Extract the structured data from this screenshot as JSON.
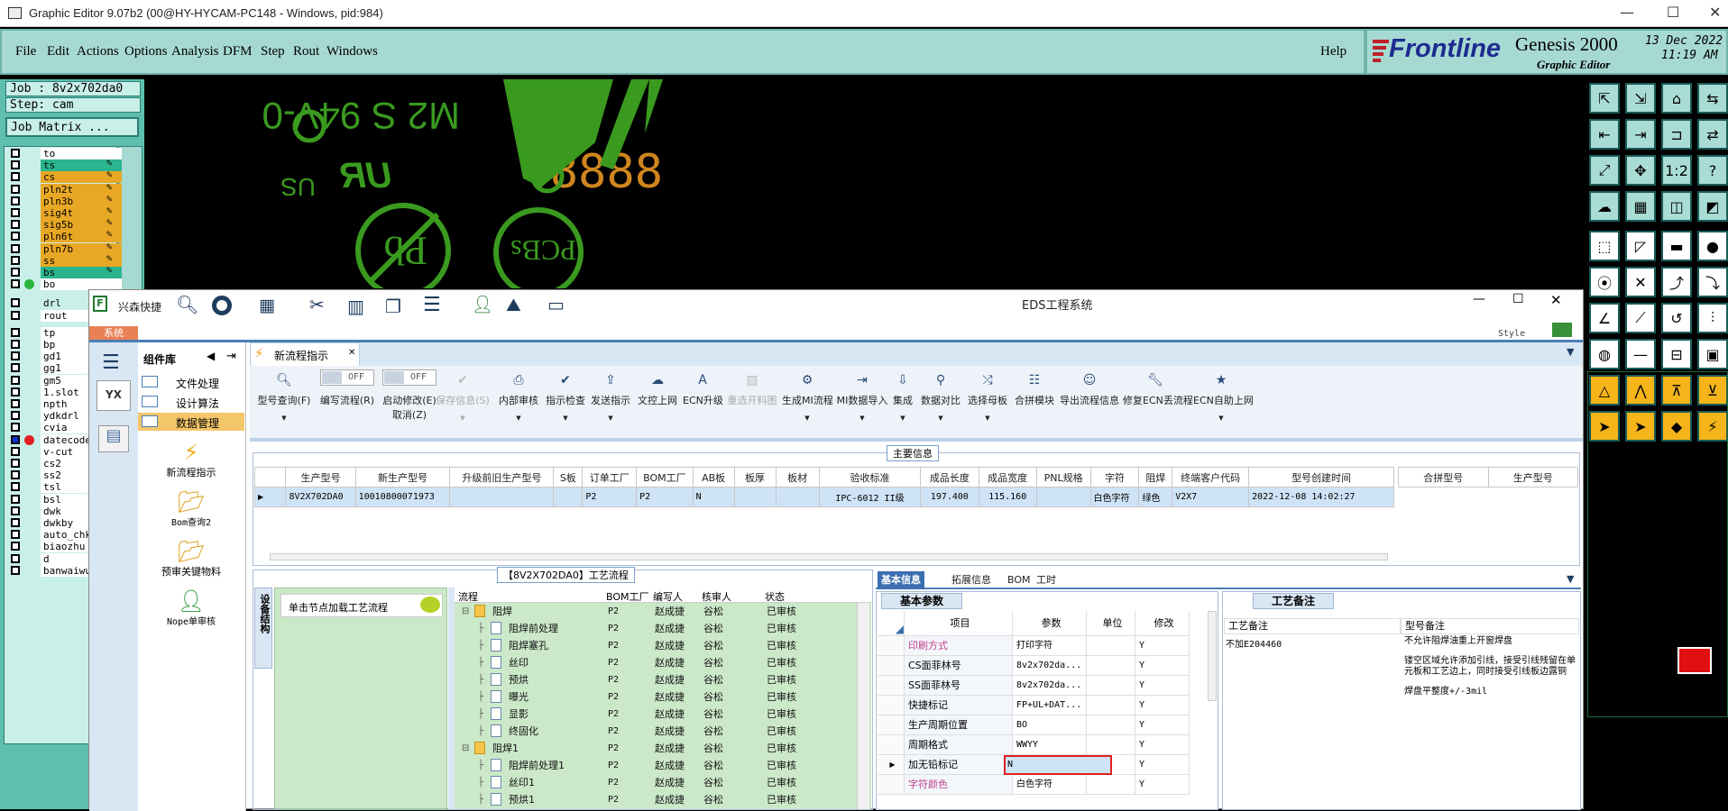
{
  "genesis": {
    "title": "Graphic Editor 9.07b2 (00@HY-HYCAM-PC148 - Windows, pid:984)",
    "menu": [
      "File",
      "Edit",
      "Actions",
      "Options",
      "Analysis",
      "DFM",
      "Step",
      "Rout",
      "Windows"
    ],
    "help": "Help",
    "brand": "Frontline",
    "product": "Genesis 2000",
    "subtitle": "Graphic Editor",
    "date": "13 Dec 2022",
    "time": "11:19 AM",
    "job": "Job : 8v2x702da0",
    "step": "Step: cam",
    "job_matrix": "Job Matrix ...",
    "layers": [
      {
        "name": "to",
        "color": "#ffffff"
      },
      {
        "name": "ts",
        "color": "#2bb58e"
      },
      {
        "name": "cs",
        "color": "#e8a825"
      },
      {
        "name": "pln2t",
        "color": "#e8a825"
      },
      {
        "name": "pln3b",
        "color": "#e8a825"
      },
      {
        "name": "sig4t",
        "color": "#e8a825"
      },
      {
        "name": "sig5b",
        "color": "#e8a825"
      },
      {
        "name": "pln6t",
        "color": "#e8a825"
      },
      {
        "name": "pln7b",
        "color": "#e8a825"
      },
      {
        "name": "ss",
        "color": "#e8a825"
      },
      {
        "name": "bs",
        "color": "#2bb58e"
      },
      {
        "name": "bo",
        "color": "#ffffff"
      },
      {
        "name": "drl",
        "color": "#c9efe9"
      },
      {
        "name": "rout",
        "color": "#ffffff"
      },
      {
        "name": "tp",
        "color": "#ffffff"
      },
      {
        "name": "bp",
        "color": "#ffffff"
      },
      {
        "name": "gd1",
        "color": "#ffffff"
      },
      {
        "name": "gg1",
        "color": "#ffffff"
      },
      {
        "name": "gm5",
        "color": "#ffffff"
      },
      {
        "name": "1.slot",
        "color": "#ffffff"
      },
      {
        "name": "npth",
        "color": "#ffffff"
      },
      {
        "name": "ydkdrl",
        "color": "#ffffff"
      },
      {
        "name": "cvia",
        "color": "#ffffff"
      },
      {
        "name": "datecode",
        "color": "#ffffff"
      },
      {
        "name": "v-cut",
        "color": "#ffffff"
      },
      {
        "name": "cs2",
        "color": "#ffffff"
      },
      {
        "name": "ss2",
        "color": "#ffffff"
      },
      {
        "name": "tsl",
        "color": "#ffffff"
      },
      {
        "name": "bsl",
        "color": "#ffffff"
      },
      {
        "name": "dwk",
        "color": "#ffffff"
      },
      {
        "name": "dwkby",
        "color": "#ffffff"
      },
      {
        "name": "auto_chk",
        "color": "#ffffff"
      },
      {
        "name": "biaozhu",
        "color": "#ffffff"
      },
      {
        "name": "d",
        "color": "#ffffff"
      },
      {
        "name": "banwaiwu",
        "color": "#ffffff"
      }
    ],
    "canvas_text": {
      "ul": "M2 S 94V-0",
      "digits": "8888",
      "us": "US",
      "pcbs": "PCBs",
      "pb": "Pb"
    },
    "colors": {
      "green": "#3a9a1f",
      "orange": "#d0861e",
      "teal": "#a7d9d3"
    }
  },
  "eds": {
    "quick_label": "兴森快捷",
    "title": "EDS工程系统",
    "style_label": "Style",
    "system_tab": "系统",
    "component_lib": "组件库",
    "sidebar_menu": [
      "文件处理",
      "设计算法",
      "数据管理"
    ],
    "sidebar_items": [
      "新流程指示",
      "Bom查询2",
      "预审关键物料",
      "Nope单审核"
    ],
    "doc_tab": "新流程指示",
    "toolbar": [
      {
        "label": "型号查询(F)",
        "icon": "search"
      },
      {
        "label": "编写流程(R)",
        "icon": "toggle",
        "toggle": "OFF"
      },
      {
        "label": "启动修改(E)",
        "sub": "取消(Z)",
        "icon": "toggle",
        "toggle": "OFF"
      },
      {
        "label": "保存信息(S)",
        "icon": "check",
        "disabled": true
      },
      {
        "label": "内部审核",
        "icon": "printer"
      },
      {
        "label": "指示检查",
        "icon": "check"
      },
      {
        "label": "发送指示",
        "icon": "upload"
      },
      {
        "label": "文控上网",
        "icon": "cloud"
      },
      {
        "label": "ECN升级",
        "icon": "a"
      },
      {
        "label": "重选开料图",
        "icon": "image",
        "disabled": true
      },
      {
        "label": "生成MI流程",
        "icon": "gears"
      },
      {
        "label": "MI数据导入",
        "icon": "import"
      },
      {
        "label": "集成",
        "icon": "download"
      },
      {
        "label": "数据对比",
        "icon": "wand"
      },
      {
        "label": "选择母板",
        "icon": "shuffle"
      },
      {
        "label": "合拼模块",
        "icon": "list"
      },
      {
        "label": "导出流程信息",
        "icon": "smile"
      },
      {
        "label": "修复ECN丢流程",
        "icon": "wrench"
      },
      {
        "label": "ECN自助上网",
        "icon": "star"
      }
    ],
    "main_info_title": "主要信息",
    "main_headers": [
      "生产型号",
      "新生产型号",
      "升级前旧生产型号",
      "S板",
      "订单工厂",
      "BOM工厂",
      "AB板",
      "板厚",
      "板材",
      "验收标准",
      "成品长度",
      "成品宽度",
      "PNL规格",
      "字符",
      "阻焊",
      "终端客户代码",
      "型号创建时间"
    ],
    "main_row": [
      "8V2X702DA0",
      "10010800071973",
      "",
      "",
      "P2",
      "P2",
      "N",
      "",
      "",
      "IPC-6012 II级",
      "197.400",
      "115.160",
      "",
      "白色字符",
      "绿色",
      "V2X7",
      "2022-12-08 14:02:27"
    ],
    "merge_headers": [
      "合拼型号",
      "生产型号"
    ],
    "process_title": "【8V2X702DA0】工艺流程",
    "process_hint": "单击节点加载工艺流程",
    "device_tab": "设备结构",
    "tree_headers": [
      "流程",
      "BOM工厂",
      "编写人",
      "核审人",
      "状态"
    ],
    "tree_rows": [
      {
        "name": "阻焊",
        "level": 0,
        "folder": true,
        "bom": "P2",
        "writer": "赵成捷",
        "reviewer": "谷松",
        "status": "已审核"
      },
      {
        "name": "阻焊前处理",
        "level": 1,
        "bom": "P2",
        "writer": "赵成捷",
        "reviewer": "谷松",
        "status": "已审核"
      },
      {
        "name": "阻焊塞孔",
        "level": 1,
        "bom": "P2",
        "writer": "赵成捷",
        "reviewer": "谷松",
        "status": "已审核"
      },
      {
        "name": "丝印",
        "level": 1,
        "bom": "P2",
        "writer": "赵成捷",
        "reviewer": "谷松",
        "status": "已审核"
      },
      {
        "name": "预烘",
        "level": 1,
        "bom": "P2",
        "writer": "赵成捷",
        "reviewer": "谷松",
        "status": "已审核"
      },
      {
        "name": "曝光",
        "level": 1,
        "bom": "P2",
        "writer": "赵成捷",
        "reviewer": "谷松",
        "status": "已审核"
      },
      {
        "name": "显影",
        "level": 1,
        "bom": "P2",
        "writer": "赵成捷",
        "reviewer": "谷松",
        "status": "已审核"
      },
      {
        "name": "终固化",
        "level": 1,
        "bom": "P2",
        "writer": "赵成捷",
        "reviewer": "谷松",
        "status": "已审核"
      },
      {
        "name": "阻焊1",
        "level": 0,
        "folder": true,
        "bom": "P2",
        "writer": "赵成捷",
        "reviewer": "谷松",
        "status": "已审核"
      },
      {
        "name": "阻焊前处理1",
        "level": 1,
        "bom": "P2",
        "writer": "赵成捷",
        "reviewer": "谷松",
        "status": "已审核"
      },
      {
        "name": "丝印1",
        "level": 1,
        "bom": "P2",
        "writer": "赵成捷",
        "reviewer": "谷松",
        "status": "已审核"
      },
      {
        "name": "预烘1",
        "level": 1,
        "bom": "P2",
        "writer": "赵成捷",
        "reviewer": "谷松",
        "status": "已审核"
      }
    ],
    "info_tabs": [
      "基本信息",
      "拓展信息",
      "BOM",
      "工时"
    ],
    "basic_param_tab": "基本参数",
    "param_headers": [
      "项目",
      "参数",
      "单位",
      "修改"
    ],
    "param_rows": [
      {
        "item": "印刷方式",
        "value": "打印字符",
        "unit": "",
        "mod": "Y",
        "red": true
      },
      {
        "item": "CS面菲林号",
        "value": "8v2x702da...",
        "unit": "",
        "mod": "Y"
      },
      {
        "item": "SS面菲林号",
        "value": "8v2x702da...",
        "unit": "",
        "mod": "Y"
      },
      {
        "item": "快捷标记",
        "value": "FP+UL+DAT...",
        "unit": "",
        "mod": "Y"
      },
      {
        "item": "生产周期位置",
        "value": "BO",
        "unit": "",
        "mod": "Y"
      },
      {
        "item": "周期格式",
        "value": "WWYY",
        "unit": "",
        "mod": "Y"
      },
      {
        "item": "加无铅标记",
        "value": "N",
        "unit": "",
        "mod": "Y",
        "editing": true
      },
      {
        "item": "字符颜色",
        "value": "白色字符",
        "unit": "",
        "mod": "Y",
        "red": true
      }
    ],
    "remark_tab": "工艺备注",
    "remark_headers": [
      "工艺备注",
      "型号备注"
    ],
    "remark_left": "不加E204460",
    "remark_right": [
      "不允许阻焊油重上开窗焊盘",
      "",
      "镂空区域允许添加引线，接受引线残留在单元板和工艺边上，同时接受引线板边露铜",
      "",
      "焊盘平整度+/-3mil"
    ]
  }
}
